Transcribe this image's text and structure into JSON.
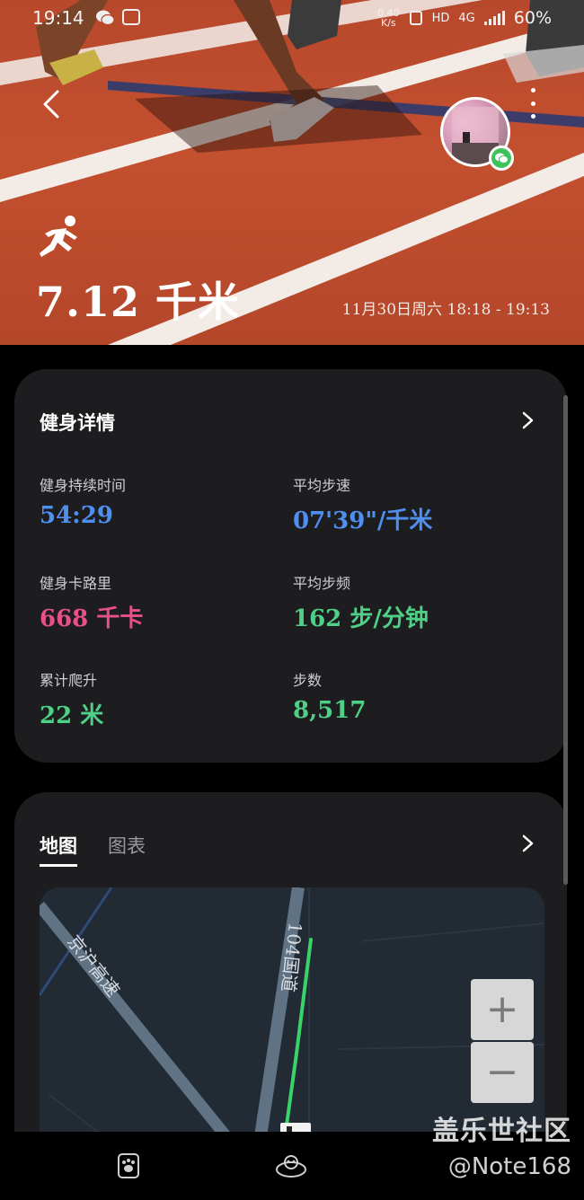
{
  "status_bar": {
    "time": "19:14",
    "net_speed_value": "0.40",
    "net_speed_unit": "K/s",
    "hd_label": "HD",
    "network_label": "4G",
    "battery": "60%"
  },
  "hero": {
    "distance": "7.12 千米",
    "session_time": "11月30日周六 18:18 - 19:13"
  },
  "details": {
    "title": "健身详情",
    "metrics": [
      {
        "label": "健身持续时间",
        "value": "54:29",
        "color": "#4f8ff0"
      },
      {
        "label": "平均步速",
        "value": "07'39\"/千米",
        "color": "#4f8ff0"
      },
      {
        "label": "健身卡路里",
        "value": "668 千卡",
        "color": "#e8508a"
      },
      {
        "label": "平均步频",
        "value": "162 步/分钟",
        "color": "#4fd087"
      },
      {
        "label": "累计爬升",
        "value": "22 米",
        "color": "#4fd087"
      },
      {
        "label": "步数",
        "value": "8,517",
        "color": "#4fd087"
      }
    ]
  },
  "map_card": {
    "tabs": [
      {
        "label": "地图",
        "active": true
      },
      {
        "label": "图表",
        "active": false
      }
    ],
    "road_labels": {
      "highway": "京沪高速",
      "national_road": "104国道"
    },
    "zoom_in": "+",
    "zoom_out": "−"
  },
  "watermark": {
    "title": "盖乐世社区",
    "handle": "@Note168"
  },
  "icons": {
    "back": "chevron-left-icon",
    "more": "more-vertical-icon",
    "runner": "running-icon",
    "avatar_badge": "wechat-icon",
    "nav_left": "paw-icon",
    "nav_center": "mascot-icon"
  }
}
